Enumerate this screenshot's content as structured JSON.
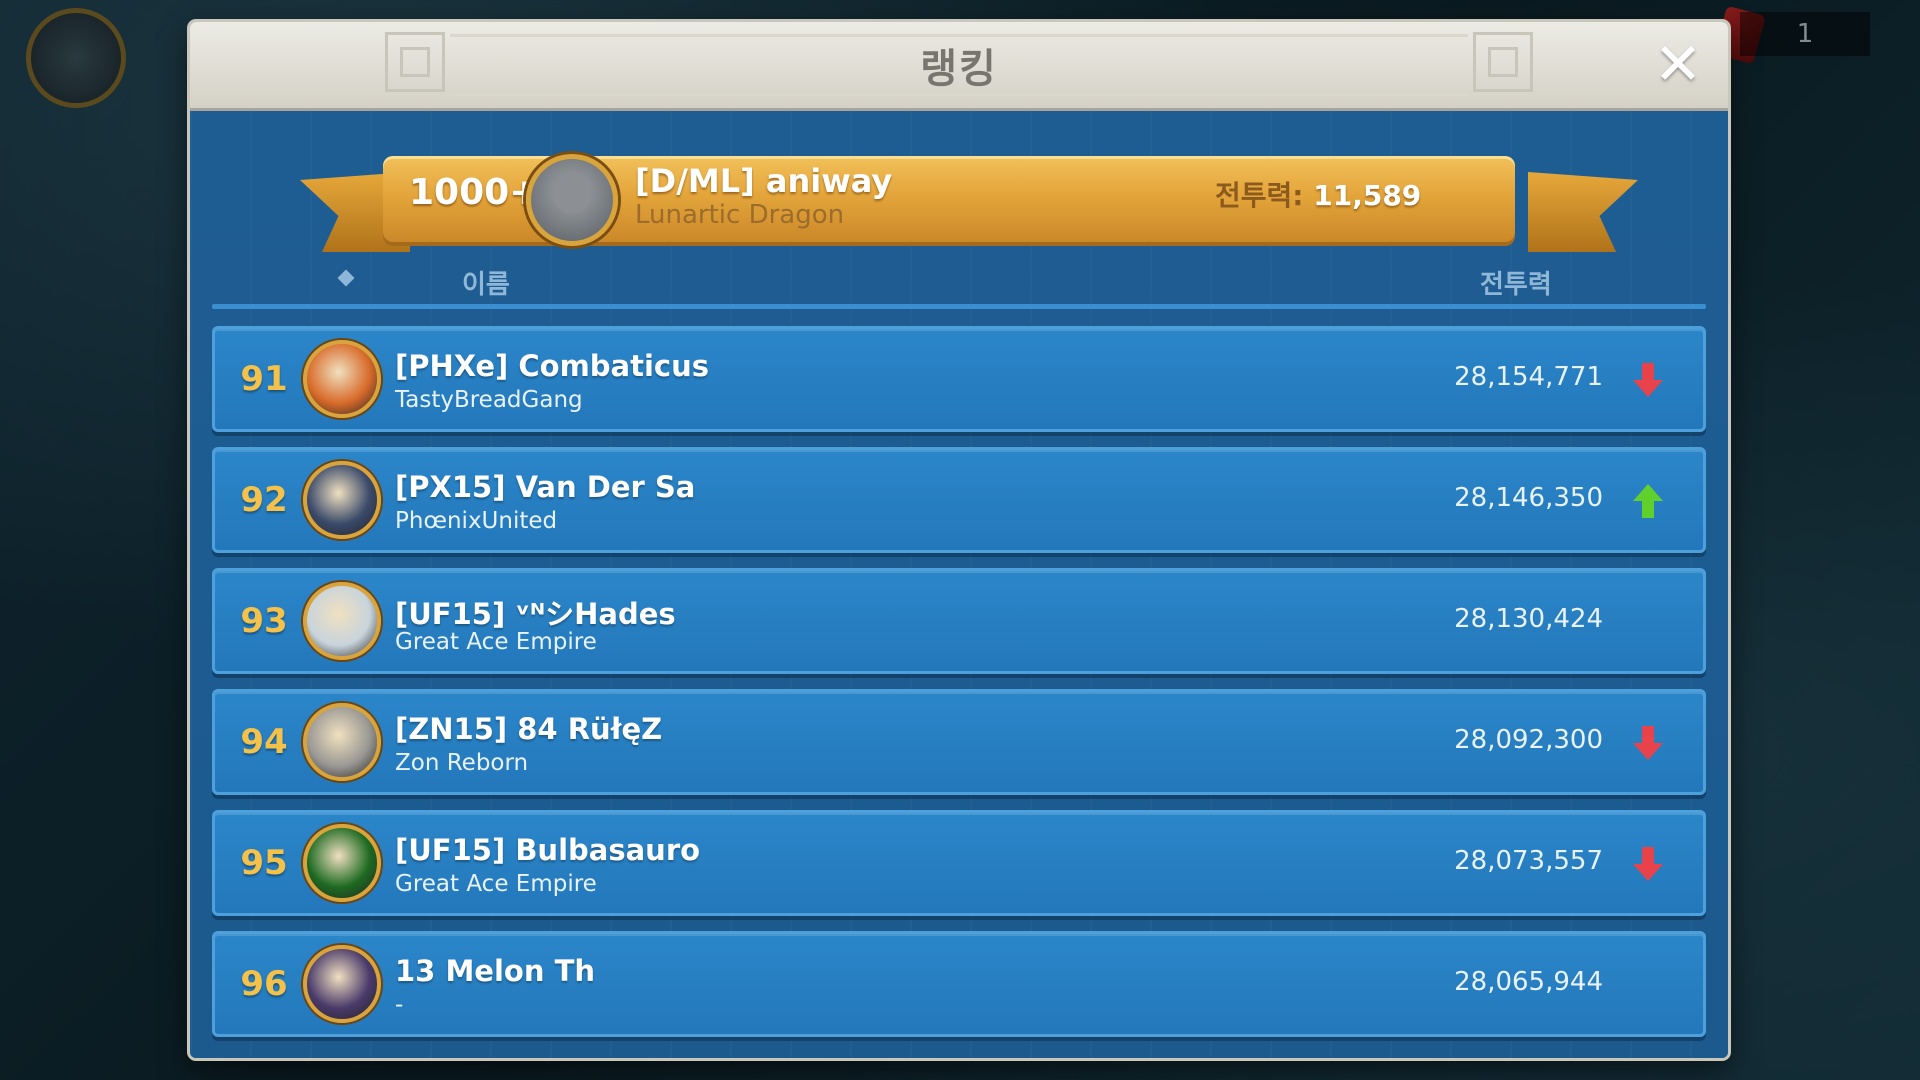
{
  "window": {
    "title": "랭킹",
    "close_icon": "close-icon"
  },
  "my_entry": {
    "rank": "1000+",
    "name": "[D/ML] aniway",
    "alliance": "Lunartic Dragon",
    "power_label": "전투력:",
    "power_value": "11,589"
  },
  "table_header": {
    "name": "이름",
    "power": "전투력"
  },
  "rows": [
    {
      "rank": "91",
      "name": "[PHXe] Combaticus",
      "alliance": "TastyBreadGang",
      "power": "28,154,771",
      "trend": "down",
      "avatar_color": "#d86b2a"
    },
    {
      "rank": "92",
      "name": "[PX15] Van Der Sa",
      "alliance": "PhœnixUnited",
      "power": "28,146,350",
      "trend": "up",
      "avatar_color": "#3a4a6a"
    },
    {
      "rank": "93",
      "name": "[UF15] ᵛᴺシHades",
      "alliance": "Great Ace Empire",
      "power": "28,130,424",
      "trend": "none",
      "avatar_color": "#c8d4dc"
    },
    {
      "rank": "94",
      "name": "[ZN15] 84 RüłęZ",
      "alliance": "Zon Reborn",
      "power": "28,092,300",
      "trend": "down",
      "avatar_color": "#9a9894"
    },
    {
      "rank": "95",
      "name": "[UF15] Bulbasauro",
      "alliance": "Great Ace Empire",
      "power": "28,073,557",
      "trend": "down",
      "avatar_color": "#1e6a22"
    },
    {
      "rank": "96",
      "name": "13 Melon Th",
      "alliance": "-",
      "power": "28,065,944",
      "trend": "none",
      "avatar_color": "#4a3a6a"
    }
  ],
  "background": {
    "counter": "1"
  },
  "colors": {
    "panel_blue": "#1f5f96",
    "row_blue": "#2378bb",
    "gold": "#e3a43a",
    "rank_gold": "#f4c24a",
    "trend_down": "#e8434a",
    "trend_up": "#5fd12a"
  }
}
